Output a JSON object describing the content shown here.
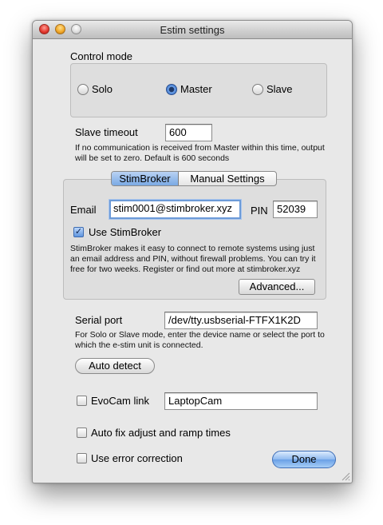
{
  "window": {
    "title": "Estim settings"
  },
  "control_mode": {
    "label": "Control mode",
    "options": [
      {
        "label": "Solo",
        "selected": false
      },
      {
        "label": "Master",
        "selected": true
      },
      {
        "label": "Slave",
        "selected": false
      }
    ]
  },
  "slave_timeout": {
    "label": "Slave timeout",
    "value": "600",
    "help": "If no communication is received from Master within this time, output will be set to zero. Default is 600 seconds"
  },
  "tabs": [
    {
      "label": "StimBroker",
      "selected": true
    },
    {
      "label": "Manual Settings",
      "selected": false
    }
  ],
  "stimbroker": {
    "email_label": "Email",
    "email_value": "stim0001@stimbroker.xyz",
    "pin_label": "PIN",
    "pin_value": "52039",
    "use_label": "Use StimBroker",
    "use_checked": true,
    "description": "StimBroker makes it easy to connect to remote systems using just an email address and PIN, without firewall problems. You can try it free for two weeks. Register or find out more at stimbroker.xyz",
    "advanced_button": "Advanced..."
  },
  "serial_port": {
    "label": "Serial port",
    "value": "/dev/tty.usbserial-FTFX1K2D",
    "help": "For Solo or Slave mode, enter the device name or select the port to which the e-stim unit is connected.",
    "auto_detect_button": "Auto detect"
  },
  "evocam": {
    "label": "EvoCam link",
    "checked": false,
    "value": "LaptopCam"
  },
  "auto_fix": {
    "label": "Auto fix adjust and ramp times",
    "checked": false
  },
  "error_correction": {
    "label": "Use error correction",
    "checked": false
  },
  "done_button": "Done",
  "colors": {
    "accent": "#6aa0e6",
    "window_bg": "#e8e8e8"
  }
}
